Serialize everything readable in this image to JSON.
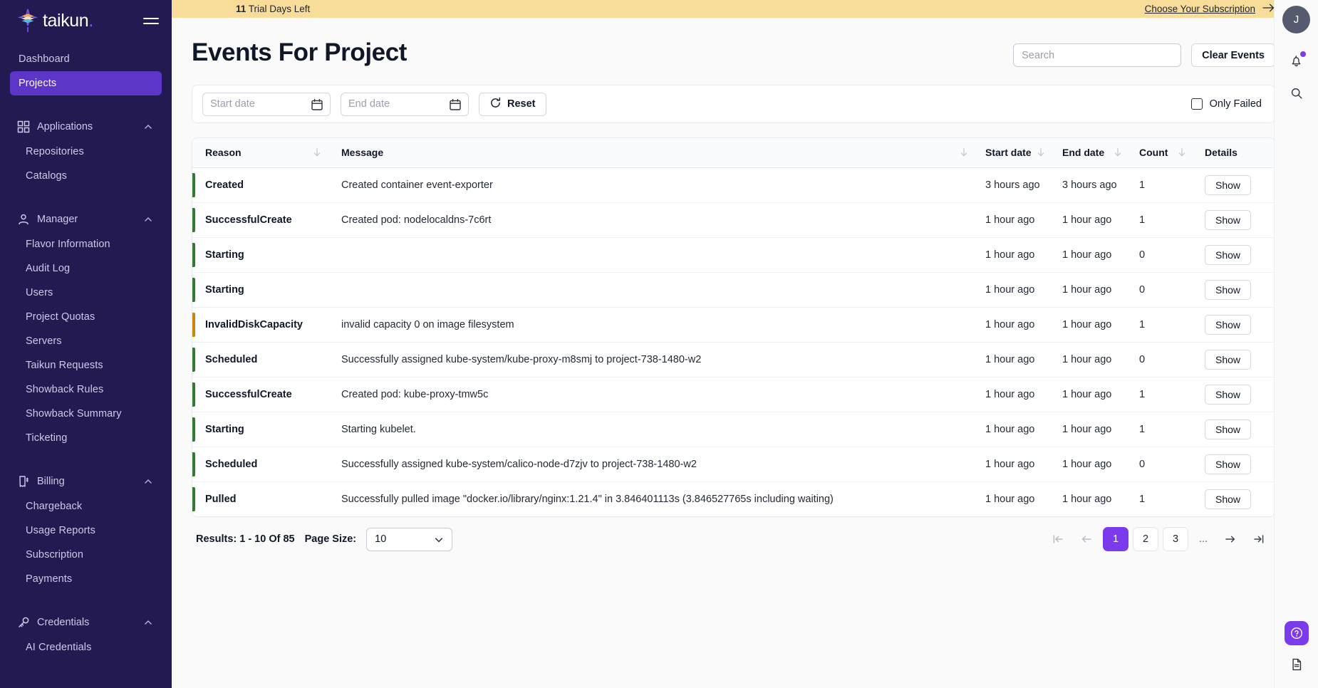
{
  "brand": {
    "name": "taikun",
    "dot": ".",
    "accent": "#7c3aed",
    "sidebar_bg": "#241a52",
    "active_bg": "#5b36c9"
  },
  "sidebar": {
    "top_links": [
      {
        "label": "Dashboard",
        "active": false
      },
      {
        "label": "Projects",
        "active": true
      }
    ],
    "groups": [
      {
        "label": "Applications",
        "icon": "grid-icon",
        "items": [
          {
            "label": "Repositories"
          },
          {
            "label": "Catalogs"
          }
        ]
      },
      {
        "label": "Manager",
        "icon": "user-icon",
        "items": [
          {
            "label": "Flavor Information"
          },
          {
            "label": "Audit Log"
          },
          {
            "label": "Users"
          },
          {
            "label": "Project Quotas"
          },
          {
            "label": "Servers"
          },
          {
            "label": "Taikun Requests"
          },
          {
            "label": "Showback Rules"
          },
          {
            "label": "Showback Summary"
          },
          {
            "label": "Ticketing"
          }
        ]
      },
      {
        "label": "Billing",
        "icon": "receipt-dollar-icon",
        "items": [
          {
            "label": "Chargeback"
          },
          {
            "label": "Usage Reports"
          },
          {
            "label": "Subscription"
          },
          {
            "label": "Payments"
          }
        ]
      },
      {
        "label": "Credentials",
        "icon": "key-icon",
        "items": [
          {
            "label": "AI Credentials"
          }
        ]
      }
    ]
  },
  "trial": {
    "days": "11",
    "text": " Trial Days Left",
    "cta": "Choose Your Subscription",
    "bg": "#f7dc9a"
  },
  "header": {
    "title": "Events For Project",
    "search_placeholder": "Search",
    "search_value": "",
    "clear_events_label": "Clear Events"
  },
  "filters": {
    "start_date_placeholder": "Start date",
    "start_date_value": "",
    "end_date_placeholder": "End date",
    "end_date_value": "",
    "reset_label": "Reset",
    "only_failed_label": "Only Failed",
    "only_failed_checked": false
  },
  "table": {
    "columns": [
      {
        "key": "reason",
        "label": "Reason",
        "sortable": true
      },
      {
        "key": "message",
        "label": "Message",
        "sortable": true
      },
      {
        "key": "sdate",
        "label": "Start date",
        "sortable": true
      },
      {
        "key": "edate",
        "label": "End date",
        "sortable": true
      },
      {
        "key": "count",
        "label": "Count",
        "sortable": true
      },
      {
        "key": "details",
        "label": "Details",
        "sortable": false
      }
    ],
    "status_colors": {
      "normal": "#2e7d32",
      "warning": "#c8860d"
    },
    "details_label": "Show",
    "rows": [
      {
        "reason": "Created",
        "status": "normal",
        "message": "Created container event-exporter",
        "sdate": "3 hours ago",
        "edate": "3 hours ago",
        "count": "1"
      },
      {
        "reason": "SuccessfulCreate",
        "status": "normal",
        "message": "Created pod: nodelocaldns-7c6rt",
        "sdate": "1 hour ago",
        "edate": "1 hour ago",
        "count": "1"
      },
      {
        "reason": "Starting",
        "status": "normal",
        "message": "",
        "sdate": "1 hour ago",
        "edate": "1 hour ago",
        "count": "0"
      },
      {
        "reason": "Starting",
        "status": "normal",
        "message": "",
        "sdate": "1 hour ago",
        "edate": "1 hour ago",
        "count": "0"
      },
      {
        "reason": "InvalidDiskCapacity",
        "status": "warning",
        "message": "invalid capacity 0 on image filesystem",
        "sdate": "1 hour ago",
        "edate": "1 hour ago",
        "count": "1"
      },
      {
        "reason": "Scheduled",
        "status": "normal",
        "message": "Successfully assigned kube-system/kube-proxy-m8smj to project-738-1480-w2",
        "sdate": "1 hour ago",
        "edate": "1 hour ago",
        "count": "0"
      },
      {
        "reason": "SuccessfulCreate",
        "status": "normal",
        "message": "Created pod: kube-proxy-tmw5c",
        "sdate": "1 hour ago",
        "edate": "1 hour ago",
        "count": "1"
      },
      {
        "reason": "Starting",
        "status": "normal",
        "message": "Starting kubelet.",
        "sdate": "1 hour ago",
        "edate": "1 hour ago",
        "count": "1"
      },
      {
        "reason": "Scheduled",
        "status": "normal",
        "message": "Successfully assigned kube-system/calico-node-d7zjv to project-738-1480-w2",
        "sdate": "1 hour ago",
        "edate": "1 hour ago",
        "count": "0"
      },
      {
        "reason": "Pulled",
        "status": "normal",
        "message": "Successfully pulled image \"docker.io/library/nginx:1.21.4\" in 3.846401113s (3.846527765s including waiting)",
        "sdate": "1 hour ago",
        "edate": "1 hour ago",
        "count": "1"
      }
    ]
  },
  "pagination": {
    "results_text": "Results: 1 - 10 Of 85",
    "page_size_label": "Page Size:",
    "page_size_value": "10",
    "pages": [
      "1",
      "2",
      "3"
    ],
    "ellipsis": "...",
    "current_page": "1"
  },
  "rail": {
    "avatar_initial": "J",
    "notification_badge": true
  }
}
